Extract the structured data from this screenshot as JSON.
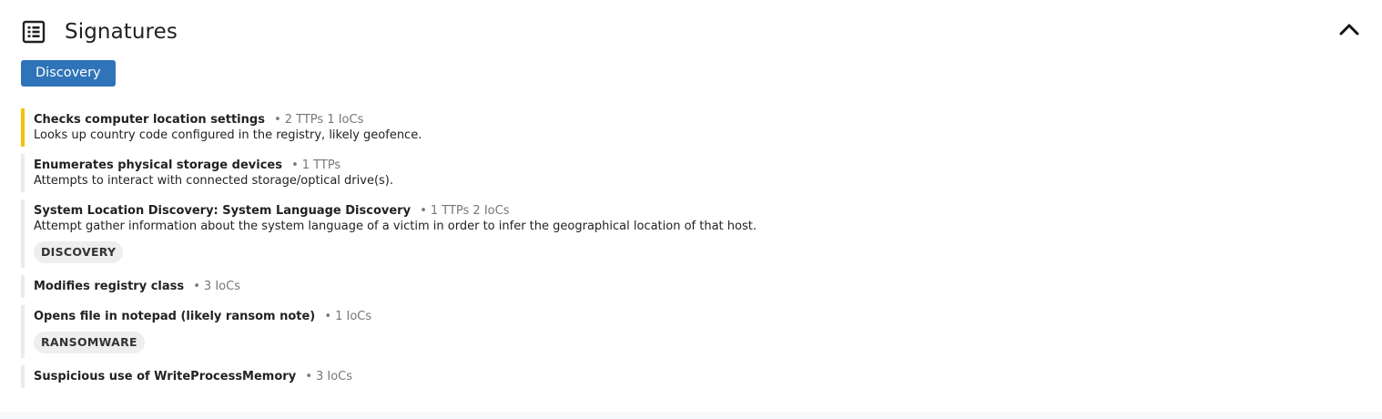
{
  "section": {
    "title": "Signatures",
    "icon": "list-icon",
    "collapse_icon": "chevron-up-icon"
  },
  "tabs": [
    {
      "label": "Discovery",
      "active": true,
      "color": "#2f74b8"
    }
  ],
  "signatures": [
    {
      "name": "Checks computer location settings",
      "meta": "2 TTPs 1 IoCs",
      "description": "Looks up country code configured in the registry, likely geofence.",
      "severity_color": "#f2c200"
    },
    {
      "name": "Enumerates physical storage devices",
      "meta": "1 TTPs",
      "description": "Attempts to interact with connected storage/optical drive(s)."
    },
    {
      "name": "System Location Discovery: System Language Discovery",
      "meta": "1 TTPs 2 IoCs",
      "description": "Attempt gather information about the system language of a victim in order to infer the geographical location of that host.",
      "tag": "DISCOVERY"
    },
    {
      "name": "Modifies registry class",
      "meta": "3 IoCs"
    },
    {
      "name": "Opens file in notepad (likely ransom note)",
      "meta": "1 IoCs",
      "tag": "RANSOMWARE"
    },
    {
      "name": "Suspicious use of WriteProcessMemory",
      "meta": "3 IoCs"
    }
  ]
}
